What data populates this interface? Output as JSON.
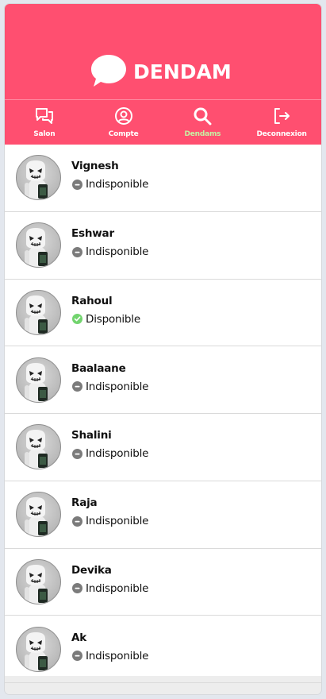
{
  "app": {
    "brand": "DENDAM",
    "colors": {
      "header": "#ff4f70",
      "active_nav": "#c7f2a4",
      "available": "#72d46e",
      "unavailable": "#7b7b7b"
    }
  },
  "nav": [
    {
      "label": "Salon",
      "icon": "chat-icon",
      "active": false
    },
    {
      "label": "Compte",
      "icon": "user-circle-icon",
      "active": false
    },
    {
      "label": "Dendams",
      "icon": "search-icon",
      "active": true
    },
    {
      "label": "Deconnexion",
      "icon": "logout-icon",
      "active": false
    }
  ],
  "users": [
    {
      "name": "Vignesh",
      "status": "Indisponible",
      "available": false
    },
    {
      "name": "Eshwar",
      "status": "Indisponible",
      "available": false
    },
    {
      "name": "Rahoul",
      "status": "Disponible",
      "available": true
    },
    {
      "name": "Baalaane",
      "status": "Indisponible",
      "available": false
    },
    {
      "name": "Shalini",
      "status": "Indisponible",
      "available": false
    },
    {
      "name": "Raja",
      "status": "Indisponible",
      "available": false
    },
    {
      "name": "Devika",
      "status": "Indisponible",
      "available": false
    },
    {
      "name": "Ak",
      "status": "Indisponible",
      "available": false
    }
  ]
}
